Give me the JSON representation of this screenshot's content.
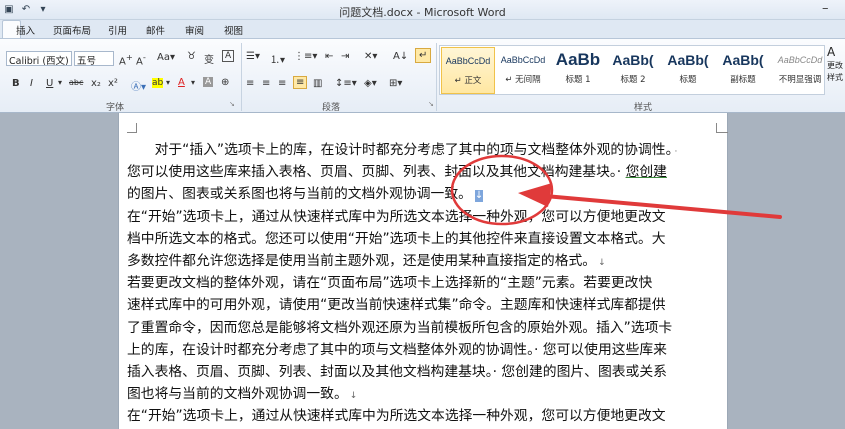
{
  "window": {
    "title": "问题文档.docx - Microsoft Word"
  },
  "tabs": [
    "插入",
    "页面布局",
    "引用",
    "邮件",
    "审阅",
    "视图"
  ],
  "font_group": {
    "font_name": "Calibri (西文)",
    "font_size": "五号",
    "label": "字体"
  },
  "paragraph_group": {
    "label": "段落"
  },
  "styles_group": {
    "label": "样式",
    "items": [
      {
        "sample": "AaBbCcDd",
        "name": "↵ 正文",
        "active": true
      },
      {
        "sample": "AaBbCcDd",
        "name": "↵ 无间隔",
        "active": false
      },
      {
        "sample": "AaBb",
        "name": "标题 1",
        "active": false
      },
      {
        "sample": "AaBb(",
        "name": "标题 2",
        "active": false
      },
      {
        "sample": "AaBb(",
        "name": "标题",
        "active": false
      },
      {
        "sample": "AaBb(",
        "name": "副标题",
        "active": false
      },
      {
        "sample": "AaBbCcDd",
        "name": "不明显强调",
        "active": false
      }
    ],
    "change_styles": "更改样式"
  },
  "document": {
    "lines": [
      {
        "text": "　　对于“插入”选项卡上的库，在设计时都充分考虑了其中的项与文档整体外观的协调性。",
        "end": "·"
      },
      {
        "text": "您可以使用这些库来插入表格、页眉、页脚、列表、封面以及其他文档构建基块。· ",
        "green": "您创建",
        "end": ""
      },
      {
        "text": "的图片、图表或关系图也将与当前的文档外观协调一致。",
        "end": "↓",
        "selected": true
      },
      {
        "text": "在“开始”选项卡上，通过从快速样式库中为所选文本选择一种外观，您可以方便地更改文",
        "end": ""
      },
      {
        "text": "档中所选文本的格式。您还可以使用“开始”选项卡上的其他控件来直接设置文本格式。大",
        "end": ""
      },
      {
        "text": "多数控件都允许您选择是使用当前主题外观，还是使用某种直接指定的格式。",
        "end": "↓"
      },
      {
        "text": "若要更改文档的整体外观，请在“页面布局”选项卡上选择新的“主题”元素。若要更改快",
        "end": ""
      },
      {
        "text": "速样式库中的可用外观，请使用“更改当前快速样式集”命令。主题库和快速样式库都提供",
        "end": ""
      },
      {
        "text": "了重置命令，因而您总是能够将文档外观还原为当前模板所包含的原始外观。插入”选项卡",
        "end": ""
      },
      {
        "text": "上的库，在设计时都充分考虑了其中的项与文档整体外观的协调性。· 您可以使用这些库来",
        "end": ""
      },
      {
        "text": "插入表格、页眉、页脚、列表、封面以及其他文档构建基块。· 您创建的图片、图表或关系",
        "end": ""
      },
      {
        "text": "图也将与当前的文档外观协调一致。",
        "end": "↓"
      },
      {
        "text": "在“开始”选项卡上，通过从快速样式库中为所选文本选择一种外观，您可以方便地更改文",
        "end": ""
      }
    ]
  },
  "colors": {
    "annotation": "#e03a3a",
    "selection": "#7ea6dc",
    "ribbon_bg": "#e6edf6"
  }
}
